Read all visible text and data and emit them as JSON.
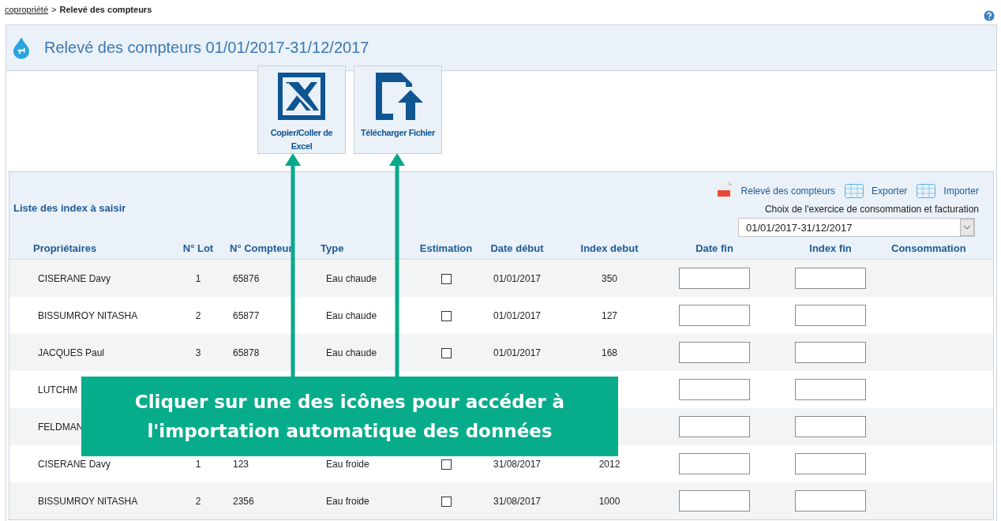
{
  "breadcrumb": {
    "link": "copropriété",
    "separator": ">",
    "current": "Relevé des compteurs"
  },
  "page_title": "Relevé des compteurs 01/01/2017-31/12/2017",
  "actions": [
    {
      "kind": "excel",
      "label": "Copier/Coller de Excel"
    },
    {
      "kind": "upload",
      "label": "Télécharger Fichier"
    }
  ],
  "list": {
    "title": "Liste des index à saisir",
    "tools": [
      {
        "kind": "pdf",
        "label": "Relevé des compteurs"
      },
      {
        "kind": "grid",
        "label": "Exporter"
      },
      {
        "kind": "grid",
        "label": "Importer"
      }
    ],
    "period_label": "Choix de l'exercice de consommation et facturation",
    "period_value": "01/01/2017-31/12/2017"
  },
  "table": {
    "columns": [
      "Propriétaires",
      "N° Lot",
      "N° Compteur",
      "Type",
      "Estimation",
      "Date début",
      "Index debut",
      "Date fin",
      "Index fin",
      "Consommation"
    ],
    "rows": [
      {
        "owner": "CISERANE Davy",
        "lot": "1",
        "meter": "65876",
        "type": "Eau chaude",
        "estimation": false,
        "start_date": "01/01/2017",
        "start_index": "350"
      },
      {
        "owner": "BISSUMROY NITASHA",
        "lot": "2",
        "meter": "65877",
        "type": "Eau chaude",
        "estimation": false,
        "start_date": "01/01/2017",
        "start_index": "127"
      },
      {
        "owner": "JACQUES Paul",
        "lot": "3",
        "meter": "65878",
        "type": "Eau chaude",
        "estimation": false,
        "start_date": "01/01/2017",
        "start_index": "168"
      },
      {
        "owner": "LUTCHM"
      },
      {
        "owner": "FELDMAN"
      },
      {
        "owner": "CISERANE Davy",
        "lot": "1",
        "meter": "123",
        "type": "Eau froide",
        "estimation": false,
        "start_date": "31/08/2017",
        "start_index": "2012"
      },
      {
        "owner": "BISSUMROY NITASHA",
        "lot": "2",
        "meter": "2356",
        "type": "Eau froide",
        "estimation": false,
        "start_date": "31/08/2017",
        "start_index": "1000"
      }
    ]
  },
  "callout": {
    "text": "Cliquer sur une des icônes pour accéder à l'importation automatique des données"
  }
}
